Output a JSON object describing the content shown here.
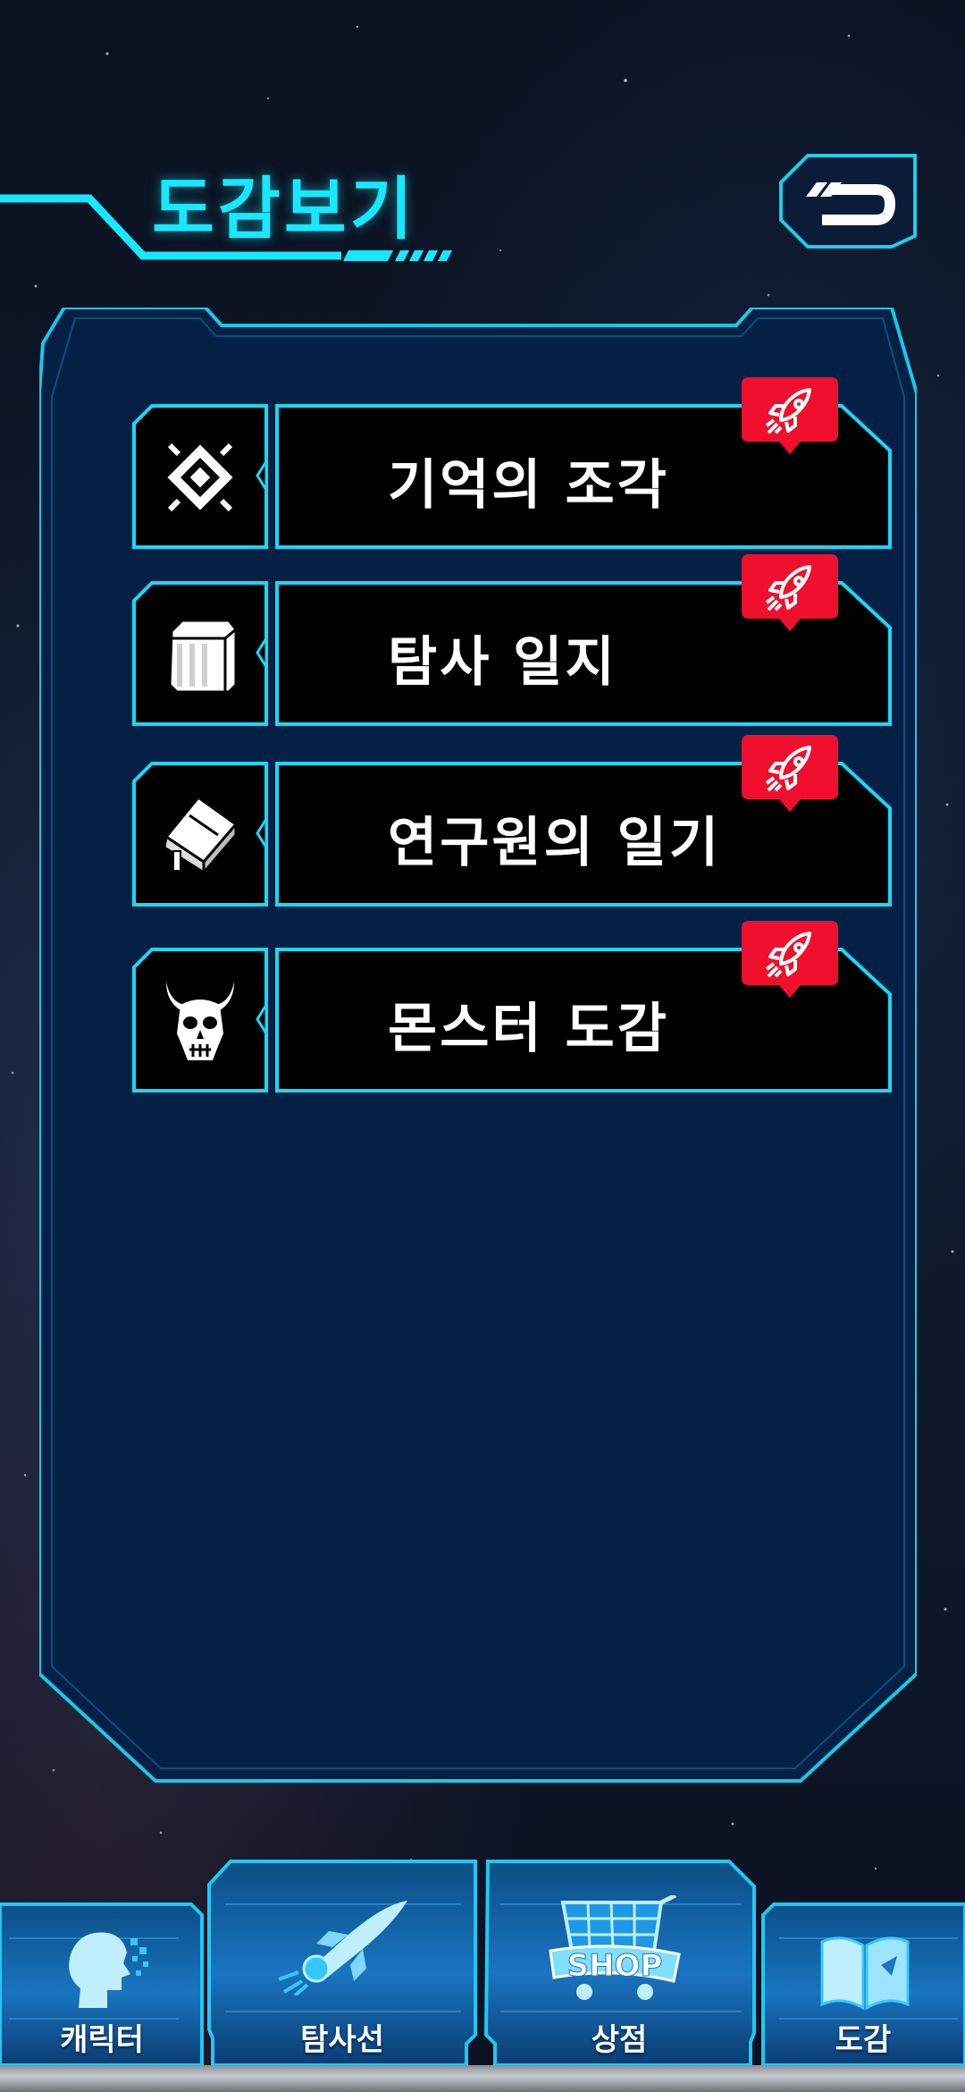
{
  "header": {
    "title": "도감보기",
    "back_icon": "back-arrow-icon"
  },
  "colors": {
    "accent": "#18e8ff",
    "panel": "#042145",
    "badge": "#f0102e"
  },
  "entries": [
    {
      "label": "기억의 조각",
      "icon": "memory-fragment-icon",
      "badge_icon": "rocket-icon"
    },
    {
      "label": "탐사 일지",
      "icon": "crate-icon",
      "badge_icon": "rocket-icon"
    },
    {
      "label": "연구원의 일기",
      "icon": "diary-book-icon",
      "badge_icon": "rocket-icon"
    },
    {
      "label": "몬스터 도감",
      "icon": "monster-skull-icon",
      "badge_icon": "rocket-icon"
    }
  ],
  "nav": {
    "tabs": [
      {
        "label": "캐릭터",
        "icon": "character-head-icon"
      },
      {
        "label": "탐사선",
        "icon": "spaceship-icon"
      },
      {
        "label": "상점",
        "icon": "shop-cart-icon",
        "icon_text": "SHOP"
      },
      {
        "label": "도감",
        "icon": "open-book-icon"
      }
    ]
  }
}
